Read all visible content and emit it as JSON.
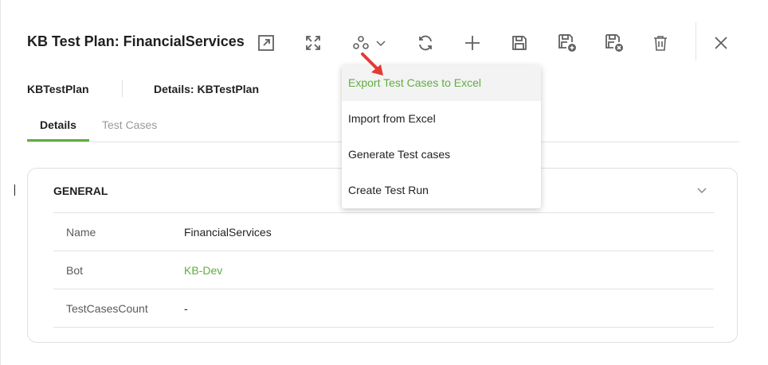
{
  "header": {
    "title": "KB Test Plan: FinancialServices"
  },
  "toolbar": {
    "icons": [
      "open-external-icon",
      "expand-icon",
      "actions-icon",
      "refresh-icon",
      "add-icon",
      "save-icon",
      "save-and-new-icon",
      "save-and-close-icon",
      "delete-icon",
      "close-icon"
    ]
  },
  "breadcrumb": {
    "root": "KBTestPlan",
    "details": "Details: KBTestPlan"
  },
  "tabs": [
    {
      "label": "Details",
      "active": true
    },
    {
      "label": "Test Cases",
      "active": false
    }
  ],
  "general": {
    "title": "GENERAL",
    "rows": [
      {
        "label": "Name",
        "value": "FinancialServices"
      },
      {
        "label": "Bot",
        "value": "KB-Dev"
      },
      {
        "label": "TestCasesCount",
        "value": "-"
      }
    ]
  },
  "menu": {
    "items": [
      {
        "label": "Export Test Cases to Excel"
      },
      {
        "label": "Import from Excel"
      },
      {
        "label": "Generate Test cases"
      },
      {
        "label": "Create Test Run"
      }
    ]
  },
  "colors": {
    "accent": "#5fae3f",
    "annotation_arrow": "#e53935",
    "icon": "#606060"
  }
}
